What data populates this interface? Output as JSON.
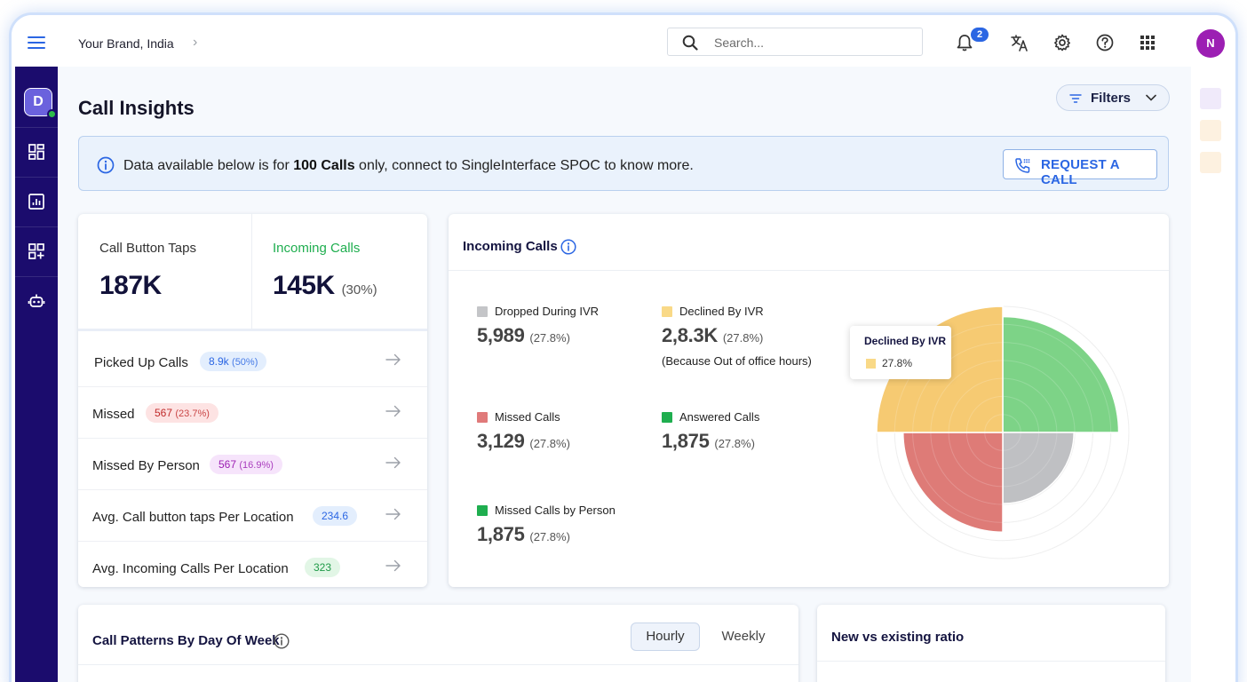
{
  "topbar": {
    "brand": "Your Brand, India",
    "search_placeholder": "Search...",
    "notification_count": "2",
    "user_initial": "N"
  },
  "sidebar": {
    "avatar_initial": "D",
    "items": [
      "dashboard-icon",
      "report-icon",
      "add-widget-icon",
      "bot-icon"
    ]
  },
  "page": {
    "title": "Call Insights",
    "filters_label": "Filters"
  },
  "banner": {
    "text_before": "Data available below is for ",
    "highlight": "100 Calls",
    "text_after": " only, connect to SingleInterface SPOC to know more.",
    "button_label": "REQUEST A CALL"
  },
  "stats": {
    "call_button_taps": {
      "label": "Call Button Taps",
      "value": "187K"
    },
    "incoming_calls": {
      "label": "Incoming Calls",
      "value": "145K",
      "pct": "(30%)"
    },
    "rows": [
      {
        "label": "Picked Up Calls",
        "value": "8.9k",
        "sub": "(50%)"
      },
      {
        "label": "Missed",
        "value": "567",
        "sub": "(23.7%)"
      },
      {
        "label": "Missed By Person",
        "value": "567",
        "sub": "(16.9%)"
      },
      {
        "label": "Avg. Call button taps Per Location",
        "value": "234.6",
        "sub": ""
      },
      {
        "label": "Avg. Incoming Calls Per Location",
        "value": "323",
        "sub": ""
      }
    ]
  },
  "incoming_card": {
    "title": "Incoming Calls",
    "legend": [
      {
        "name": "Dropped During IVR",
        "value": "5,989",
        "pct": "(27.8%)",
        "color": "#c4c5c8"
      },
      {
        "name": "Declined By IVR",
        "value": "2,8.3K",
        "pct": "(27.8%)",
        "note": "(Because Out of office hours)",
        "color": "#f9d987"
      },
      {
        "name": "Missed Calls",
        "value": "3,129",
        "pct": "(27.8%)",
        "color": "#e07a7a"
      },
      {
        "name": "Answered Calls",
        "value": "1,875",
        "pct": "(27.8%)",
        "color": "#1fae4f"
      },
      {
        "name": "Missed Calls by Person",
        "value": "1,875",
        "pct": "(27.8%)",
        "color": "#1fae4f"
      }
    ],
    "tooltip": {
      "title": "Declined By IVR",
      "value": "27.8%"
    }
  },
  "chart_data": {
    "type": "polar-area",
    "categories": [
      "Answered Calls",
      "Dropped During IVR",
      "Missed Calls",
      "Declined By IVR"
    ],
    "values": [
      5.7,
      3.5,
      4.9,
      6.2
    ],
    "colors": [
      "#7dd387",
      "#bfc0c3",
      "#de7b77",
      "#f6ca72"
    ],
    "rlim": [
      0,
      6.2
    ],
    "grid": true
  },
  "patterns": {
    "title": "Call Patterns By Day Of Week",
    "tab_hourly": "Hourly",
    "tab_weekly": "Weekly"
  },
  "ratio": {
    "title": "New vs existing ratio"
  }
}
